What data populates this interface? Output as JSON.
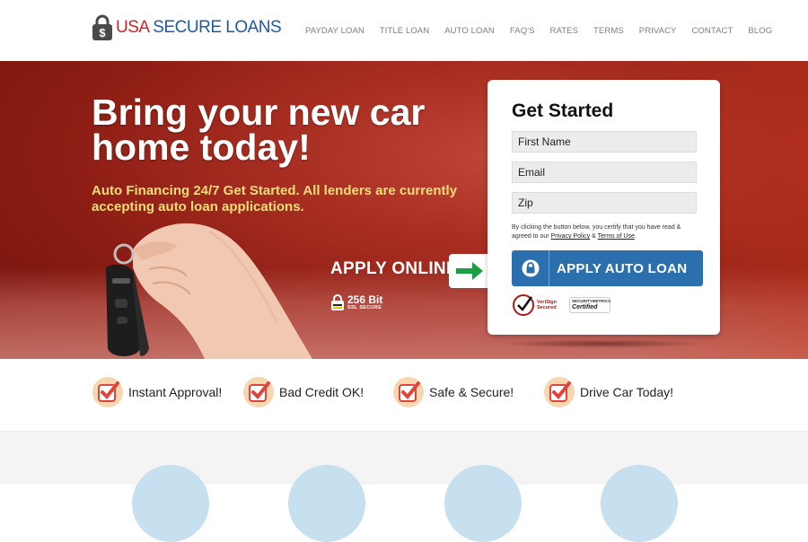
{
  "header": {
    "logo": {
      "part1": "USA",
      "part2": " SECURE LOANS"
    },
    "nav": [
      "PAYDAY LOAN",
      "TITLE LOAN",
      "AUTO LOAN",
      "FAQ'S",
      "RATES",
      "TERMS",
      "PRIVACY",
      "CONTACT",
      "BLOG"
    ]
  },
  "hero": {
    "title": "Bring your new car home today!",
    "subtitle": "Auto Financing 24/7 Get Started. All lenders are currently accepting auto loan applications.",
    "apply_online": "APPLY ONLINE",
    "ssl": {
      "bits": "256 Bit",
      "label": "SSL SECURE"
    }
  },
  "form": {
    "title": "Get Started",
    "fields": {
      "first_name": "First Name",
      "email": "Email",
      "zip": "Zip"
    },
    "disclaimer_pre": "By clicking the button below, you certify that you have read & agreed to our ",
    "privacy_link": "Privacy Policy",
    "amp": " & ",
    "terms_link": "Terms of Use",
    "disclaimer_post": ".",
    "button_label": "APPLY AUTO LOAN",
    "badges": {
      "verisign_line1": "VeriSign",
      "verisign_line2": "Secured",
      "securitymetrics_line1": "SECURITYMETRICS",
      "securitymetrics_line2": "Certified"
    }
  },
  "features": [
    "Instant Approval!",
    "Bad Credit OK!",
    "Safe & Secure!",
    "Drive Car Today!"
  ],
  "colors": {
    "brand_red": "#d2232a",
    "brand_blue": "#1f5aa6",
    "button_blue": "#2b6fae",
    "subtitle_yellow": "#f7dd7a",
    "check_red": "#e0443a"
  }
}
